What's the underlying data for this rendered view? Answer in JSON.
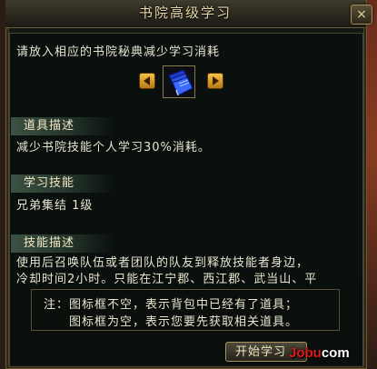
{
  "window": {
    "title": "书院高级学习",
    "close_label": "×"
  },
  "prompt": "请放入相应的书院秘典减少学习消耗",
  "item_slot": {
    "icon": "blue-book-icon"
  },
  "sections": {
    "item_desc": {
      "header": "道具描述",
      "text": "减少书院技能个人学习30%消耗。"
    },
    "learn_skill": {
      "header": "学习技能",
      "text": "兄弟集结 1级"
    },
    "skill_desc": {
      "header": "技能描述",
      "line1": "使用后召唤队伍或者团队的队友到释放技能者身边，",
      "line2": "冷却时间2小时。只能在江宁郡、西江郡、武当山、平"
    }
  },
  "note": {
    "line1": "注：图标框不空，表示背包中已经有了道具；",
    "line2": "图标框为空，表示您要先获取相关道具。"
  },
  "start_button": "开始学习",
  "watermark": {
    "red": "Jobu",
    "white": "com"
  },
  "colors": {
    "title_text": "#e8d7a6",
    "body_text": "#e9e4cf",
    "section_bg": "#3e5546",
    "arrow_gold": "#f5c245",
    "border_gold": "#a8925c"
  }
}
